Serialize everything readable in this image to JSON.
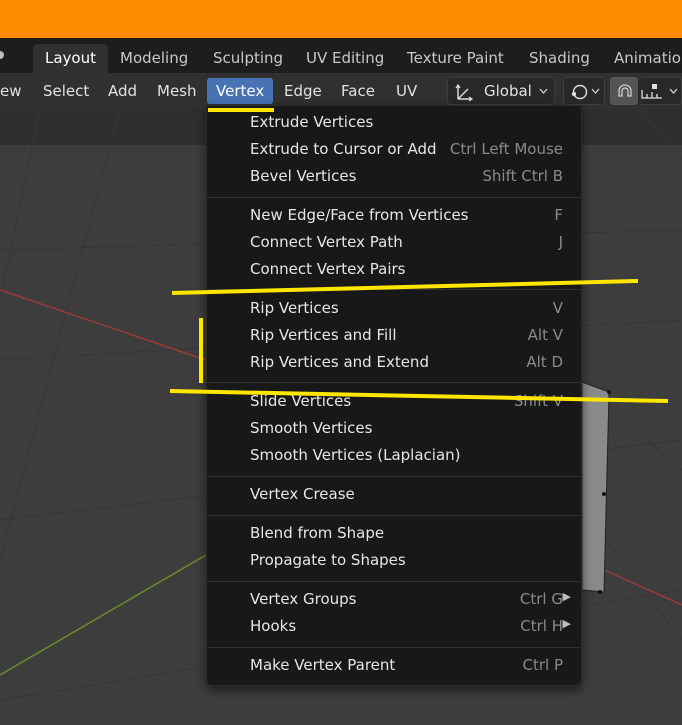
{
  "workspace_tabs": [
    {
      "label": "Layout"
    },
    {
      "label": "Modeling"
    },
    {
      "label": "Sculpting"
    },
    {
      "label": "UV Editing"
    },
    {
      "label": "Texture Paint"
    },
    {
      "label": "Shading"
    },
    {
      "label": "Animation"
    }
  ],
  "header_menus": [
    {
      "label": "ew"
    },
    {
      "label": "Select"
    },
    {
      "label": "Add"
    },
    {
      "label": "Mesh"
    },
    {
      "label": "Vertex"
    },
    {
      "label": "Edge"
    },
    {
      "label": "Face"
    },
    {
      "label": "UV"
    }
  ],
  "transform_orientation": {
    "value": "Global"
  },
  "vertex_menu": {
    "items": [
      {
        "label": "Extrude Vertices",
        "shortcut": ""
      },
      {
        "label": "Extrude to Cursor or Add",
        "shortcut": "Ctrl Left Mouse"
      },
      {
        "label": "Bevel Vertices",
        "shortcut": "Shift Ctrl B"
      },
      {
        "label": "New Edge/Face from Vertices",
        "shortcut": "F"
      },
      {
        "label": "Connect Vertex Path",
        "shortcut": "J"
      },
      {
        "label": "Connect Vertex Pairs",
        "shortcut": ""
      },
      {
        "label": "Rip Vertices",
        "shortcut": "V"
      },
      {
        "label": "Rip Vertices and Fill",
        "shortcut": "Alt V"
      },
      {
        "label": "Rip Vertices and Extend",
        "shortcut": "Alt D"
      },
      {
        "label": "Slide Vertices",
        "shortcut": "Shift V"
      },
      {
        "label": "Smooth Vertices",
        "shortcut": ""
      },
      {
        "label": "Smooth Vertices (Laplacian)",
        "shortcut": ""
      },
      {
        "label": "Vertex Crease",
        "shortcut": ""
      },
      {
        "label": "Blend from Shape",
        "shortcut": ""
      },
      {
        "label": "Propagate to Shapes",
        "shortcut": ""
      },
      {
        "label": "Vertex Groups",
        "shortcut": "Ctrl G"
      },
      {
        "label": "Hooks",
        "shortcut": "Ctrl H"
      },
      {
        "label": "Make Vertex Parent",
        "shortcut": "Ctrl P"
      }
    ]
  },
  "colors": {
    "title_bar": "#ff8c00",
    "menu_active": "#4772b3",
    "highlight_marks": "#ffe600",
    "x_axis": "#9b3a3a",
    "y_axis": "#6b8e23"
  }
}
